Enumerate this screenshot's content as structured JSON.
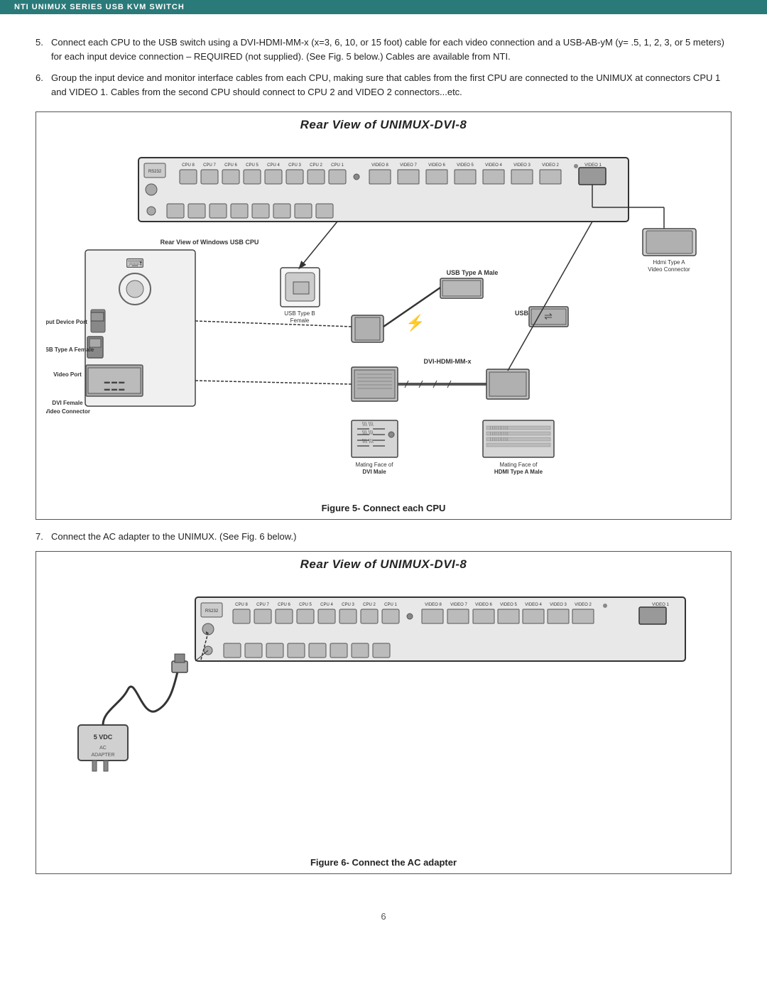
{
  "header": {
    "title": "NTI UNIMUX SERIES USB KVM SWITCH"
  },
  "items": [
    {
      "num": "5.",
      "text": "Connect each CPU to the USB switch using a DVI-HDMI-MM-x  (x=3, 6, 10, or 15 foot) cable for each video connection and a USB-AB-yM (y= .5, 1, 2, 3, or 5 meters) for each input device connection –   REQUIRED (not supplied).  (See Fig. 5 below.)   Cables are available from NTI."
    },
    {
      "num": "6.",
      "text": "Group the input device and monitor interface cables from each CPU,  making sure that cables from the first CPU are connected to the UNIMUX at connectors CPU 1 and  VIDEO 1.   Cables from the second CPU should connect  to CPU 2 and VIDEO 2 connectors...etc."
    }
  ],
  "figure5": {
    "title": "Rear View of UNIMUX-DVI-8",
    "caption": "Figure 5-  Connect each CPU"
  },
  "item7": {
    "num": "7.",
    "text": "Connect the AC adapter to the UNIMUX.  (See Fig. 6 below.)"
  },
  "figure6": {
    "title": "Rear View of UNIMUX-DVI-8",
    "caption": "Figure 6-  Connect the AC adapter"
  },
  "labels": {
    "rear_view_windows": "Rear View of Windows USB CPU",
    "input_device_port": "Input Device Port",
    "usb_type_a_female": "USB Type A Female",
    "video_port": "Video Port",
    "dvi_female_video_connector": "DVI Female\nVideo Connector",
    "usb_type_b_female": "USB Type B\nFemale",
    "usb_type_a_male": "USB Type A Male",
    "usb_ab_xm": "USB-AB-xM",
    "dvi_hdmi_mm_x": "DVI-HDMI-MM-x",
    "mating_face_dvi_male": "Mating Face of\nDVI Male",
    "mating_face_hdmi_type_a_male": "Mating Face of\nHDMI Type A Male",
    "hdmi_type_a_video_connector": "Hdmi Type A\nVideo Connector",
    "vdc_5": "5 VDC",
    "ac_adapter": "AC\nADAPTER"
  },
  "page_number": "6"
}
